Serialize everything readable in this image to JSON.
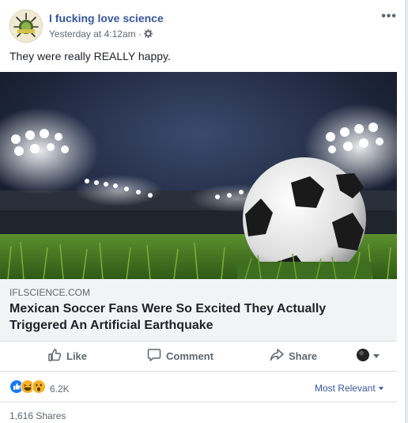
{
  "post": {
    "page_name": "I fucking love science",
    "timestamp": "Yesterday at 4:12am",
    "separator": "·",
    "message": "They were really REALLY happy.",
    "icons": {
      "audience": "gear-icon",
      "more": "more-options-icon"
    }
  },
  "link": {
    "domain": "IFLSCIENCE.COM",
    "title": "Mexican Soccer Fans Were So Excited They Actually Triggered An Artificial Earthquake"
  },
  "actions": {
    "like": "Like",
    "comment": "Comment",
    "share": "Share"
  },
  "reactions": {
    "count": "6.2K",
    "sort_label": "Most Relevant",
    "types": [
      "like",
      "haha",
      "wow"
    ],
    "colors": {
      "like": "#1877f2",
      "haha": "#f7b125",
      "brand": "#365899"
    }
  },
  "footer": {
    "shares": "1,616 Shares"
  }
}
